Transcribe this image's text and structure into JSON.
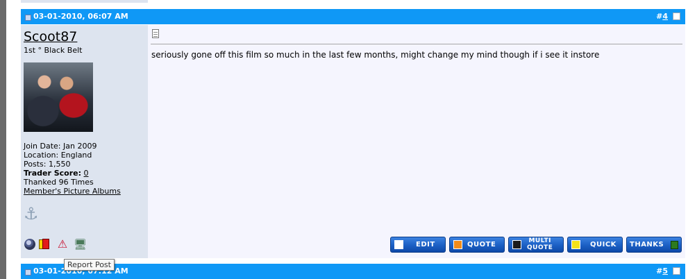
{
  "post": {
    "date": "03-01-2010, 06:07 AM",
    "number_prefix": "#",
    "number": "4"
  },
  "user": {
    "name": "Scoot87",
    "title": "1st ° Black Belt",
    "join_date": "Join Date: Jan 2009",
    "location": "Location: England",
    "posts": "Posts: 1,550",
    "trader_label": "Trader Score:",
    "trader_score": "0",
    "thanked": "Thanked 96 Times",
    "albums_link": "Member's Picture Albums"
  },
  "message": {
    "text": "seriously gone off this film so much in the last few months, might change my mind though if i see it instore"
  },
  "buttons": {
    "edit": "EDIT",
    "quote": "QUOTE",
    "multi_line1": "MULTI",
    "multi_line2": "QUOTE",
    "quick": "QUICK",
    "thanks": "THANKS"
  },
  "tooltip": {
    "text": "Report Post"
  },
  "next_post": {
    "date": "03-01-2010, 07:12 AM",
    "number_prefix": "#",
    "number": "5"
  },
  "icons": {
    "doc": "document-icon",
    "checkbox": "select-post-checkbox",
    "online": "online-status-icon",
    "cards": "yellow-red-card-icon",
    "report": "report-post-icon",
    "ip": "ip-address-icon",
    "reputation": "reputation-anchor-icon"
  },
  "colors": {
    "header_bar": "#0f98f6",
    "user_panel": "#dde4ef",
    "post_body": "#f5f5fe",
    "button_blue": "#1b5fc4"
  }
}
